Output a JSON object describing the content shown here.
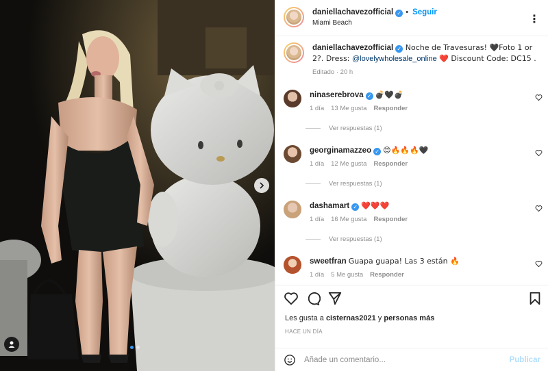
{
  "post": {
    "username": "daniellachavezofficial",
    "follow_label": "Seguir",
    "location": "Miami Beach",
    "more_label": "⋮"
  },
  "caption": {
    "username": "daniellachavezofficial",
    "text_before": " Noche de Travesuras! 🖤Foto 1 or 2?. Dress: ",
    "mention": "@lovelywholesale_online",
    "text_after": " ❤️ Discount Code: DC15 .",
    "edited": "Editado · 20 h"
  },
  "comments": [
    {
      "username": "ninaserebrova",
      "text": "💣🖤💣",
      "age": "1 día",
      "likes": "13 Me gusta",
      "reply": "Responder",
      "replies": "Ver respuestas (1)"
    },
    {
      "username": "georginamazzeo",
      "text": "😍🔥🔥🔥🖤",
      "age": "1 día",
      "likes": "12 Me gusta",
      "reply": "Responder",
      "replies": "Ver respuestas (1)"
    },
    {
      "username": "dashamart",
      "text": "❤️❤️❤️",
      "age": "1 día",
      "likes": "16 Me gusta",
      "reply": "Responder",
      "replies": "Ver respuestas (1)"
    },
    {
      "username": "sweetfran",
      "text": "Guapa guapa! Las 3 están 🔥",
      "age": "1 día",
      "likes": "5 Me gusta",
      "reply": "Responder",
      "replies": ""
    }
  ],
  "likes": {
    "prefix": "Les gusta a ",
    "user": "cisternas2021",
    "middle": " y ",
    "others": "personas más"
  },
  "time_ago": "HACE UN DÍA",
  "add_comment": {
    "placeholder": "Añade un comentario...",
    "publish": "Publicar"
  },
  "colors": {
    "accent": "#0095f6",
    "verified": "#3897f0",
    "muted": "#8e8e8e"
  }
}
